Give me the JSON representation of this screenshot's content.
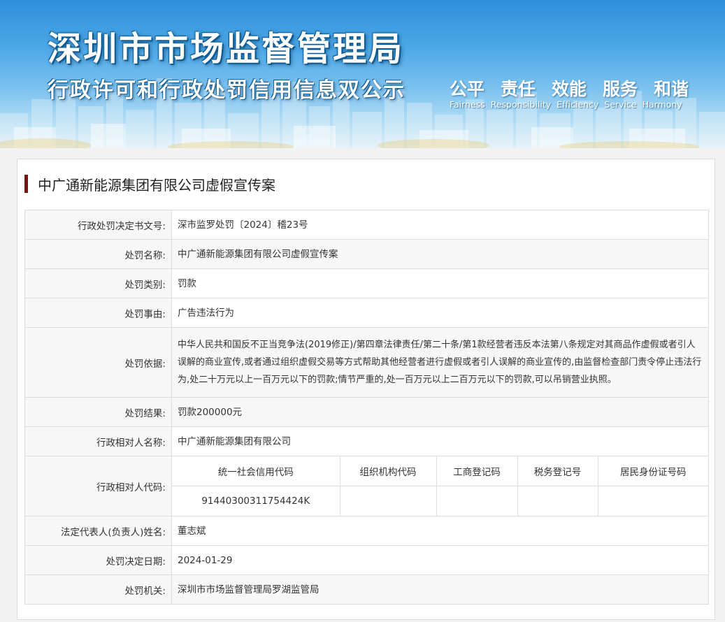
{
  "banner": {
    "title_main": "深圳市市场监督管理局",
    "title_sub": "行政许可和行政处罚信用信息双公示",
    "slogans_cn": [
      "公平",
      "责任",
      "效能",
      "服务",
      "和谐"
    ],
    "slogans_en": [
      "Fairness",
      "Responsibility",
      "Efficiency",
      "Service",
      "Harmony"
    ]
  },
  "case_title": "中广通新能源集团有限公司虚假宣传案",
  "rows": [
    {
      "label": "行政处罚决定书文号:",
      "value": "深市监罗处罚〔2024〕稽23号"
    },
    {
      "label": "处罚名称:",
      "value": "中广通新能源集团有限公司虚假宣传案"
    },
    {
      "label": "处罚类别:",
      "value": "罚款"
    },
    {
      "label": "处罚事由:",
      "value": "广告违法行为"
    },
    {
      "label": "处罚依据:",
      "value": "中华人民共和国反不正当竞争法(2019修正)/第四章法律责任/第二十条/第1款经营者违反本法第八条规定对其商品作虚假或者引人误解的商业宣传,或者通过组织虚假交易等方式帮助其他经营者进行虚假或者引人误解的商业宣传的,由监督检查部门责令停止违法行为,处二十万元以上一百万元以下的罚款;情节严重的,处一百万元以上二百万元以下的罚款,可以吊销营业执照。"
    },
    {
      "label": "处罚结果:",
      "value": "罚款200000元"
    },
    {
      "label": "行政相对人名称:",
      "value": "中广通新能源集团有限公司"
    },
    {
      "label": "法定代表人(负责人)姓名:",
      "value": "董志斌"
    },
    {
      "label": "处罚决定日期:",
      "value": "2024-01-29"
    },
    {
      "label": "处罚机关:",
      "value": "深圳市市场监督管理局罗湖监管局"
    }
  ],
  "codes": {
    "label": "行政相对人代码:",
    "headers": [
      "统一社会信用代码",
      "组织机构代码",
      "工商登记码",
      "税务登记号",
      "居民身份证号码"
    ],
    "values": [
      "91440300311754424K",
      "",
      "",
      "",
      ""
    ]
  }
}
